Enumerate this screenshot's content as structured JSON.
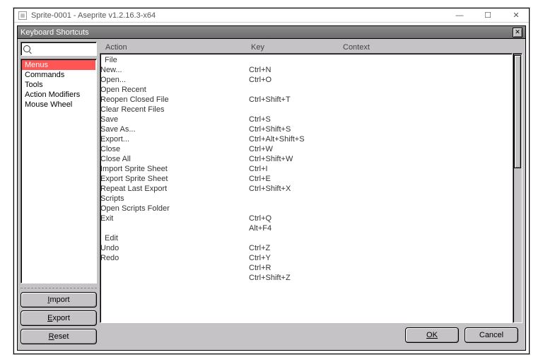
{
  "window": {
    "title": "Sprite-0001 - Aseprite v1.2.16.3-x64"
  },
  "dialog": {
    "title": "Keyboard Shortcuts",
    "search_value": "",
    "categories": [
      "Menus",
      "Commands",
      "Tools",
      "Action Modifiers",
      "Mouse Wheel"
    ],
    "selected_category": 0,
    "side_buttons": {
      "import": "Import",
      "export": "Export",
      "reset": "Reset"
    },
    "columns": {
      "action": "Action",
      "key": "Key",
      "context": "Context"
    },
    "rows": [
      {
        "type": "section",
        "label": "File"
      },
      {
        "type": "action",
        "indent": 1,
        "label": "New...",
        "key": "Ctrl+N"
      },
      {
        "type": "action",
        "indent": 1,
        "label": "Open...",
        "key": "Ctrl+O"
      },
      {
        "type": "action",
        "indent": 1,
        "label": "Open Recent",
        "key": ""
      },
      {
        "type": "action",
        "indent": 2,
        "label": "Reopen Closed File",
        "key": "Ctrl+Shift+T"
      },
      {
        "type": "action",
        "indent": 2,
        "label": "Clear Recent Files",
        "key": ""
      },
      {
        "type": "action",
        "indent": 1,
        "label": "Save",
        "key": "Ctrl+S"
      },
      {
        "type": "action",
        "indent": 1,
        "label": "Save As...",
        "key": "Ctrl+Shift+S"
      },
      {
        "type": "action",
        "indent": 1,
        "label": "Export...",
        "key": "Ctrl+Alt+Shift+S"
      },
      {
        "type": "action",
        "indent": 1,
        "label": "Close",
        "key": "Ctrl+W"
      },
      {
        "type": "action",
        "indent": 1,
        "label": "Close All",
        "key": "Ctrl+Shift+W"
      },
      {
        "type": "action",
        "indent": 1,
        "label": "Import Sprite Sheet",
        "key": "Ctrl+I"
      },
      {
        "type": "action",
        "indent": 1,
        "label": "Export Sprite Sheet",
        "key": "Ctrl+E"
      },
      {
        "type": "action",
        "indent": 1,
        "label": "Repeat Last Export",
        "key": "Ctrl+Shift+X"
      },
      {
        "type": "action",
        "indent": 1,
        "label": "Scripts",
        "key": ""
      },
      {
        "type": "action",
        "indent": 2,
        "label": "Open Scripts Folder",
        "key": ""
      },
      {
        "type": "action",
        "indent": 1,
        "label": "Exit",
        "key": "Ctrl+Q"
      },
      {
        "type": "action",
        "indent": 1,
        "label": "",
        "key": "Alt+F4"
      },
      {
        "type": "section",
        "label": "Edit"
      },
      {
        "type": "action",
        "indent": 1,
        "label": "Undo",
        "key": "Ctrl+Z"
      },
      {
        "type": "action",
        "indent": 1,
        "label": "Redo",
        "key": "Ctrl+Y"
      },
      {
        "type": "action",
        "indent": 1,
        "label": "",
        "key": "Ctrl+R"
      },
      {
        "type": "action",
        "indent": 1,
        "label": "",
        "key": "Ctrl+Shift+Z"
      }
    ],
    "footer": {
      "ok": "OK",
      "cancel": "Cancel"
    }
  }
}
